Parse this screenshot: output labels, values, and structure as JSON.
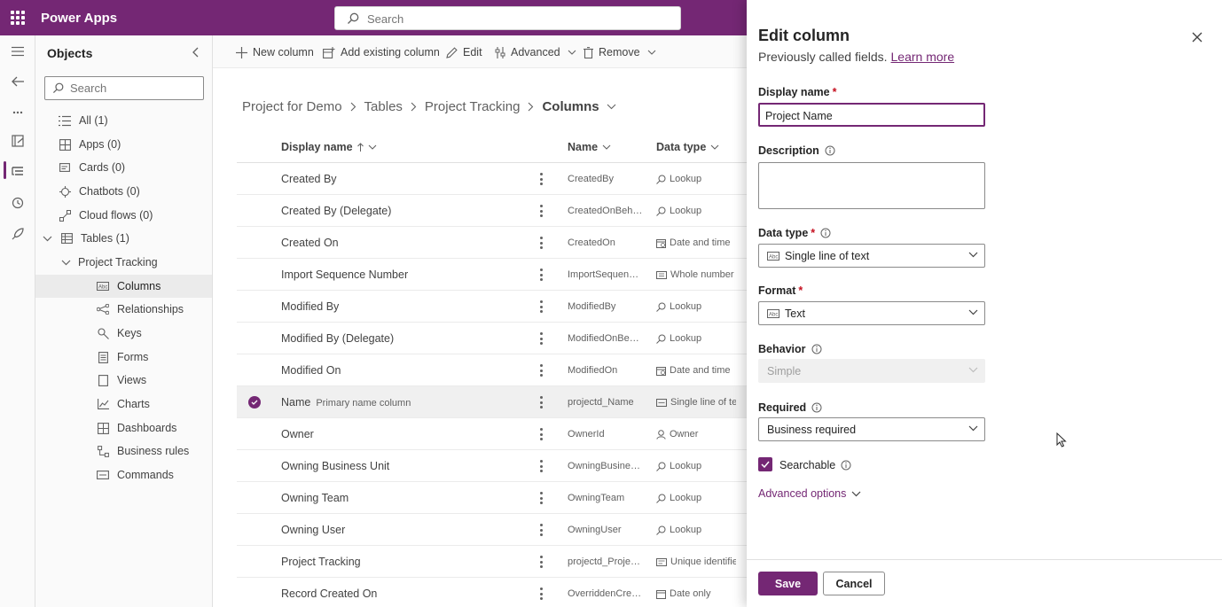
{
  "app": {
    "title": "Power Apps"
  },
  "top_search": {
    "placeholder": "Search"
  },
  "objects": {
    "title": "Objects",
    "search_placeholder": "Search",
    "items": [
      {
        "label": "All  (1)",
        "icon": "list-icon"
      },
      {
        "label": "Apps  (0)",
        "icon": "apps-icon"
      },
      {
        "label": "Cards  (0)",
        "icon": "card-icon"
      },
      {
        "label": "Chatbots  (0)",
        "icon": "bot-icon"
      },
      {
        "label": "Cloud flows  (0)",
        "icon": "flow-icon"
      },
      {
        "label": "Tables  (1)",
        "icon": "table-icon"
      },
      {
        "label": "Project Tracking",
        "icon": ""
      },
      {
        "label": "Columns",
        "icon": "text-column-icon"
      },
      {
        "label": "Relationships",
        "icon": "relationship-icon"
      },
      {
        "label": "Keys",
        "icon": "key-icon"
      },
      {
        "label": "Forms",
        "icon": "form-icon"
      },
      {
        "label": "Views",
        "icon": "view-icon"
      },
      {
        "label": "Charts",
        "icon": "chart-icon"
      },
      {
        "label": "Dashboards",
        "icon": "dashboard-icon"
      },
      {
        "label": "Business rules",
        "icon": "rules-icon"
      },
      {
        "label": "Commands",
        "icon": "command-icon"
      }
    ]
  },
  "commands": {
    "new_column": "New column",
    "add_existing": "Add existing column",
    "edit": "Edit",
    "advanced": "Advanced",
    "remove": "Remove"
  },
  "breadcrumb": {
    "project": "Project for Demo",
    "tables": "Tables",
    "table": "Project Tracking",
    "current": "Columns"
  },
  "table": {
    "headers": {
      "display_name": "Display name",
      "name": "Name",
      "data_type": "Data type"
    },
    "rows": [
      {
        "display": "Created By",
        "sub": "",
        "name": "CreatedBy",
        "type": "Lookup",
        "type_icon": "lookup-icon"
      },
      {
        "display": "Created By (Delegate)",
        "sub": "",
        "name": "CreatedOnBehalfBy",
        "type": "Lookup",
        "type_icon": "lookup-icon"
      },
      {
        "display": "Created On",
        "sub": "",
        "name": "CreatedOn",
        "type": "Date and time",
        "type_icon": "datetime-icon"
      },
      {
        "display": "Import Sequence Number",
        "sub": "",
        "name": "ImportSequenceNumber",
        "type": "Whole number",
        "type_icon": "number-icon"
      },
      {
        "display": "Modified By",
        "sub": "",
        "name": "ModifiedBy",
        "type": "Lookup",
        "type_icon": "lookup-icon"
      },
      {
        "display": "Modified By (Delegate)",
        "sub": "",
        "name": "ModifiedOnBehalfBy",
        "type": "Lookup",
        "type_icon": "lookup-icon"
      },
      {
        "display": "Modified On",
        "sub": "",
        "name": "ModifiedOn",
        "type": "Date and time",
        "type_icon": "datetime-icon"
      },
      {
        "display": "Name",
        "sub": "Primary name column",
        "name": "projectd_Name",
        "type": "Single line of text",
        "type_icon": "text-icon",
        "selected": true
      },
      {
        "display": "Owner",
        "sub": "",
        "name": "OwnerId",
        "type": "Owner",
        "type_icon": "person-icon"
      },
      {
        "display": "Owning Business Unit",
        "sub": "",
        "name": "OwningBusinessUnit",
        "type": "Lookup",
        "type_icon": "lookup-icon"
      },
      {
        "display": "Owning Team",
        "sub": "",
        "name": "OwningTeam",
        "type": "Lookup",
        "type_icon": "lookup-icon"
      },
      {
        "display": "Owning User",
        "sub": "",
        "name": "OwningUser",
        "type": "Lookup",
        "type_icon": "lookup-icon"
      },
      {
        "display": "Project Tracking",
        "sub": "",
        "name": "projectd_ProjectTrackingId",
        "type": "Unique identifier",
        "type_icon": "id-icon"
      },
      {
        "display": "Record Created On",
        "sub": "",
        "name": "OverriddenCreatedOn",
        "type": "Date only",
        "type_icon": "date-icon"
      }
    ]
  },
  "edit_panel": {
    "title": "Edit column",
    "subtitle": "Previously called fields.",
    "learn_more": "Learn more",
    "display_name_label": "Display name",
    "display_name_value": "Project Name",
    "description_label": "Description",
    "data_type_label": "Data type",
    "data_type_value": "Single line of text",
    "format_label": "Format",
    "format_value": "Text",
    "behavior_label": "Behavior",
    "behavior_value": "Simple",
    "required_label": "Required",
    "required_value": "Business required",
    "searchable_label": "Searchable",
    "searchable_checked": true,
    "advanced_options": "Advanced options",
    "save": "Save",
    "cancel": "Cancel",
    "required_marker": "*"
  },
  "colors": {
    "brand": "#742774",
    "required": "#c50f1f"
  }
}
